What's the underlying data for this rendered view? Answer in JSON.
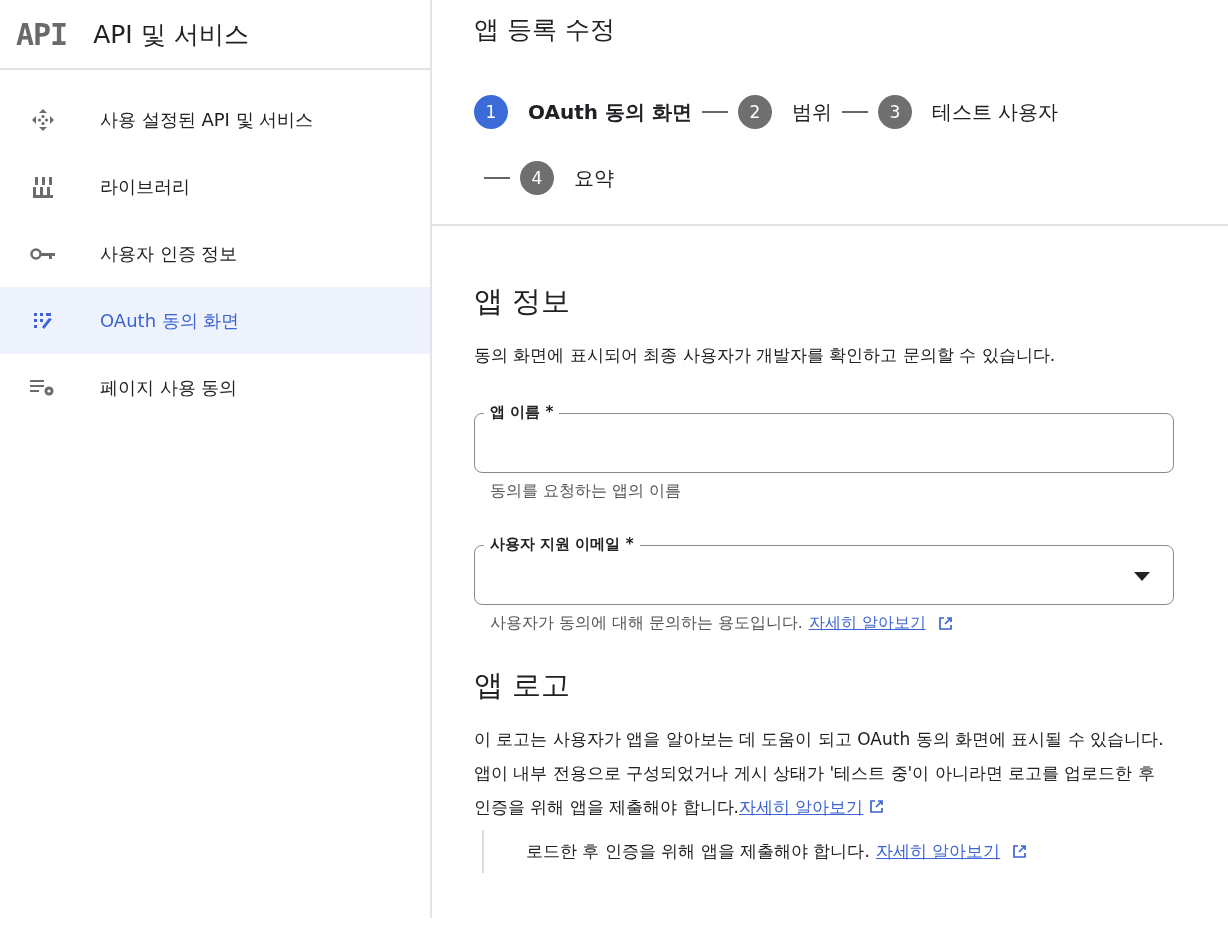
{
  "sidebar": {
    "logo": "API",
    "title": "API 및 서비스",
    "items": [
      {
        "label": "사용 설정된 API 및 서비스",
        "kind": "diamond",
        "selected": false
      },
      {
        "label": "라이브러리",
        "kind": "library",
        "selected": false
      },
      {
        "label": "사용자 인증 정보",
        "kind": "key",
        "selected": false
      },
      {
        "label": "OAuth 동의 화면",
        "kind": "consent",
        "selected": true
      },
      {
        "label": "페이지 사용 동의",
        "kind": "settings-list",
        "selected": false
      }
    ]
  },
  "main": {
    "title": "앱 등록 수정",
    "steps": [
      {
        "number": "1",
        "label": "OAuth 동의 화면",
        "selected": true
      },
      {
        "number": "2",
        "label": "범위",
        "selected": false
      },
      {
        "number": "3",
        "label": "테스트 사용자",
        "selected": false
      },
      {
        "number": "4",
        "label": "요약",
        "selected": false
      }
    ],
    "app_info": {
      "heading": "앱 정보",
      "description": "동의 화면에 표시되어 최종 사용자가 개발자를 확인하고 문의할 수 있습니다.",
      "fields": [
        {
          "kind": "text",
          "label": "앱 이름 *",
          "helper": "동의를 요청하는 앱의 이름"
        },
        {
          "kind": "dropdown",
          "label": "사용자 지원 이메일 *",
          "helper": "사용자가 동의에 대해 문의하는 용도입니다.",
          "link": "자세히 알아보기"
        }
      ]
    },
    "app_logo": {
      "heading": "앱 로고",
      "paragraphs": [
        {
          "text": "이 로고는 사용자가 앱을 알아보는 데 도움이 되고 OAuth 동의 화면에 표시될 수 있습니다."
        },
        {
          "text": "앱이 내부 전용으로 구성되었거나 게시 상태가 '테스트 중'이 아니라면 로고를 업로드한 후 인증을 위해 앱을 제출해야 합니다.",
          "link": "자세히 알아보기"
        }
      ],
      "quote": {
        "text": "로드한 후 인증을 위해 앱을 제출해야 합니다.",
        "link": "자세히 알아보기"
      }
    }
  }
}
